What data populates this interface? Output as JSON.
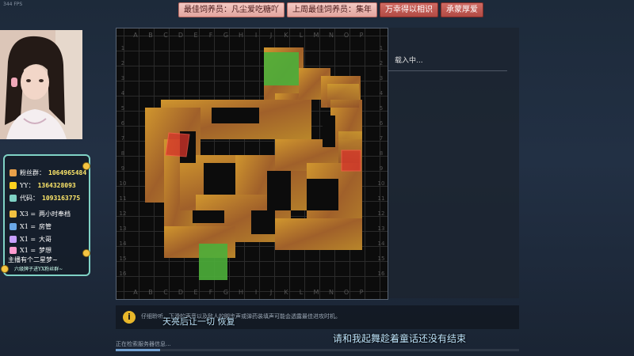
{
  "fps_label": "344 FPS",
  "banner": {
    "tags": [
      "最佳饲养员：凡尘爱吃糖吖",
      "上周最佳饲养员：集年",
      "万幸得以相识",
      "承蒙厚爱"
    ]
  },
  "streamer_panel": {
    "rows": [
      {
        "label": "粉丝群：",
        "value": "1064965484",
        "icon": "fan-group-icon",
        "color": "#e8a04a"
      },
      {
        "label": "YY：",
        "value": "1364328093",
        "icon": "yy-icon",
        "color": "#ffd21f"
      },
      {
        "label": "代码：",
        "value": "1093163775",
        "icon": "code-icon",
        "color": "#7fd2c5"
      },
      {
        "label": "X3 =",
        "value": "两小时奉档",
        "icon": "pencil-icon",
        "color": "#f0c040"
      },
      {
        "label": "X1 =",
        "value": "房管",
        "icon": "shield-icon",
        "color": "#6aa8e8"
      },
      {
        "label": "X1 =",
        "value": "大哥",
        "icon": "sword-icon",
        "color": "#c8a0ff"
      },
      {
        "label": "X1 =",
        "value": "梦想",
        "icon": "star-icon",
        "color": "#ff9bd0"
      }
    ],
    "motto": "主播有个二星梦~",
    "motto_sub": "六级牌子进YX粉丝群~"
  },
  "map": {
    "columns": [
      "A",
      "B",
      "C",
      "D",
      "E",
      "F",
      "G",
      "H",
      "I",
      "J",
      "K",
      "L",
      "M",
      "N",
      "O",
      "P"
    ],
    "rows": [
      "1",
      "2",
      "3",
      "4",
      "5",
      "6",
      "7",
      "8",
      "9",
      "10",
      "11",
      "12",
      "13",
      "14",
      "15",
      "16"
    ],
    "zone_colors": {
      "spawn": "#4caf3a",
      "bombsite": "#d8342a"
    }
  },
  "side": {
    "loading_text": "载入中..."
  },
  "tip": {
    "icon": "info-icon",
    "text": "仔细聆听，下滑的声音以及敌人的脚步声或弹药装填声可能会透露最佳进攻时机。"
  },
  "subtitles": {
    "line1": "天亮后让一切 恢复",
    "line2": "请和我起舞趁着童话还没有结束"
  },
  "status": {
    "text": "正在检索服务器信息...",
    "progress": 0.11
  }
}
